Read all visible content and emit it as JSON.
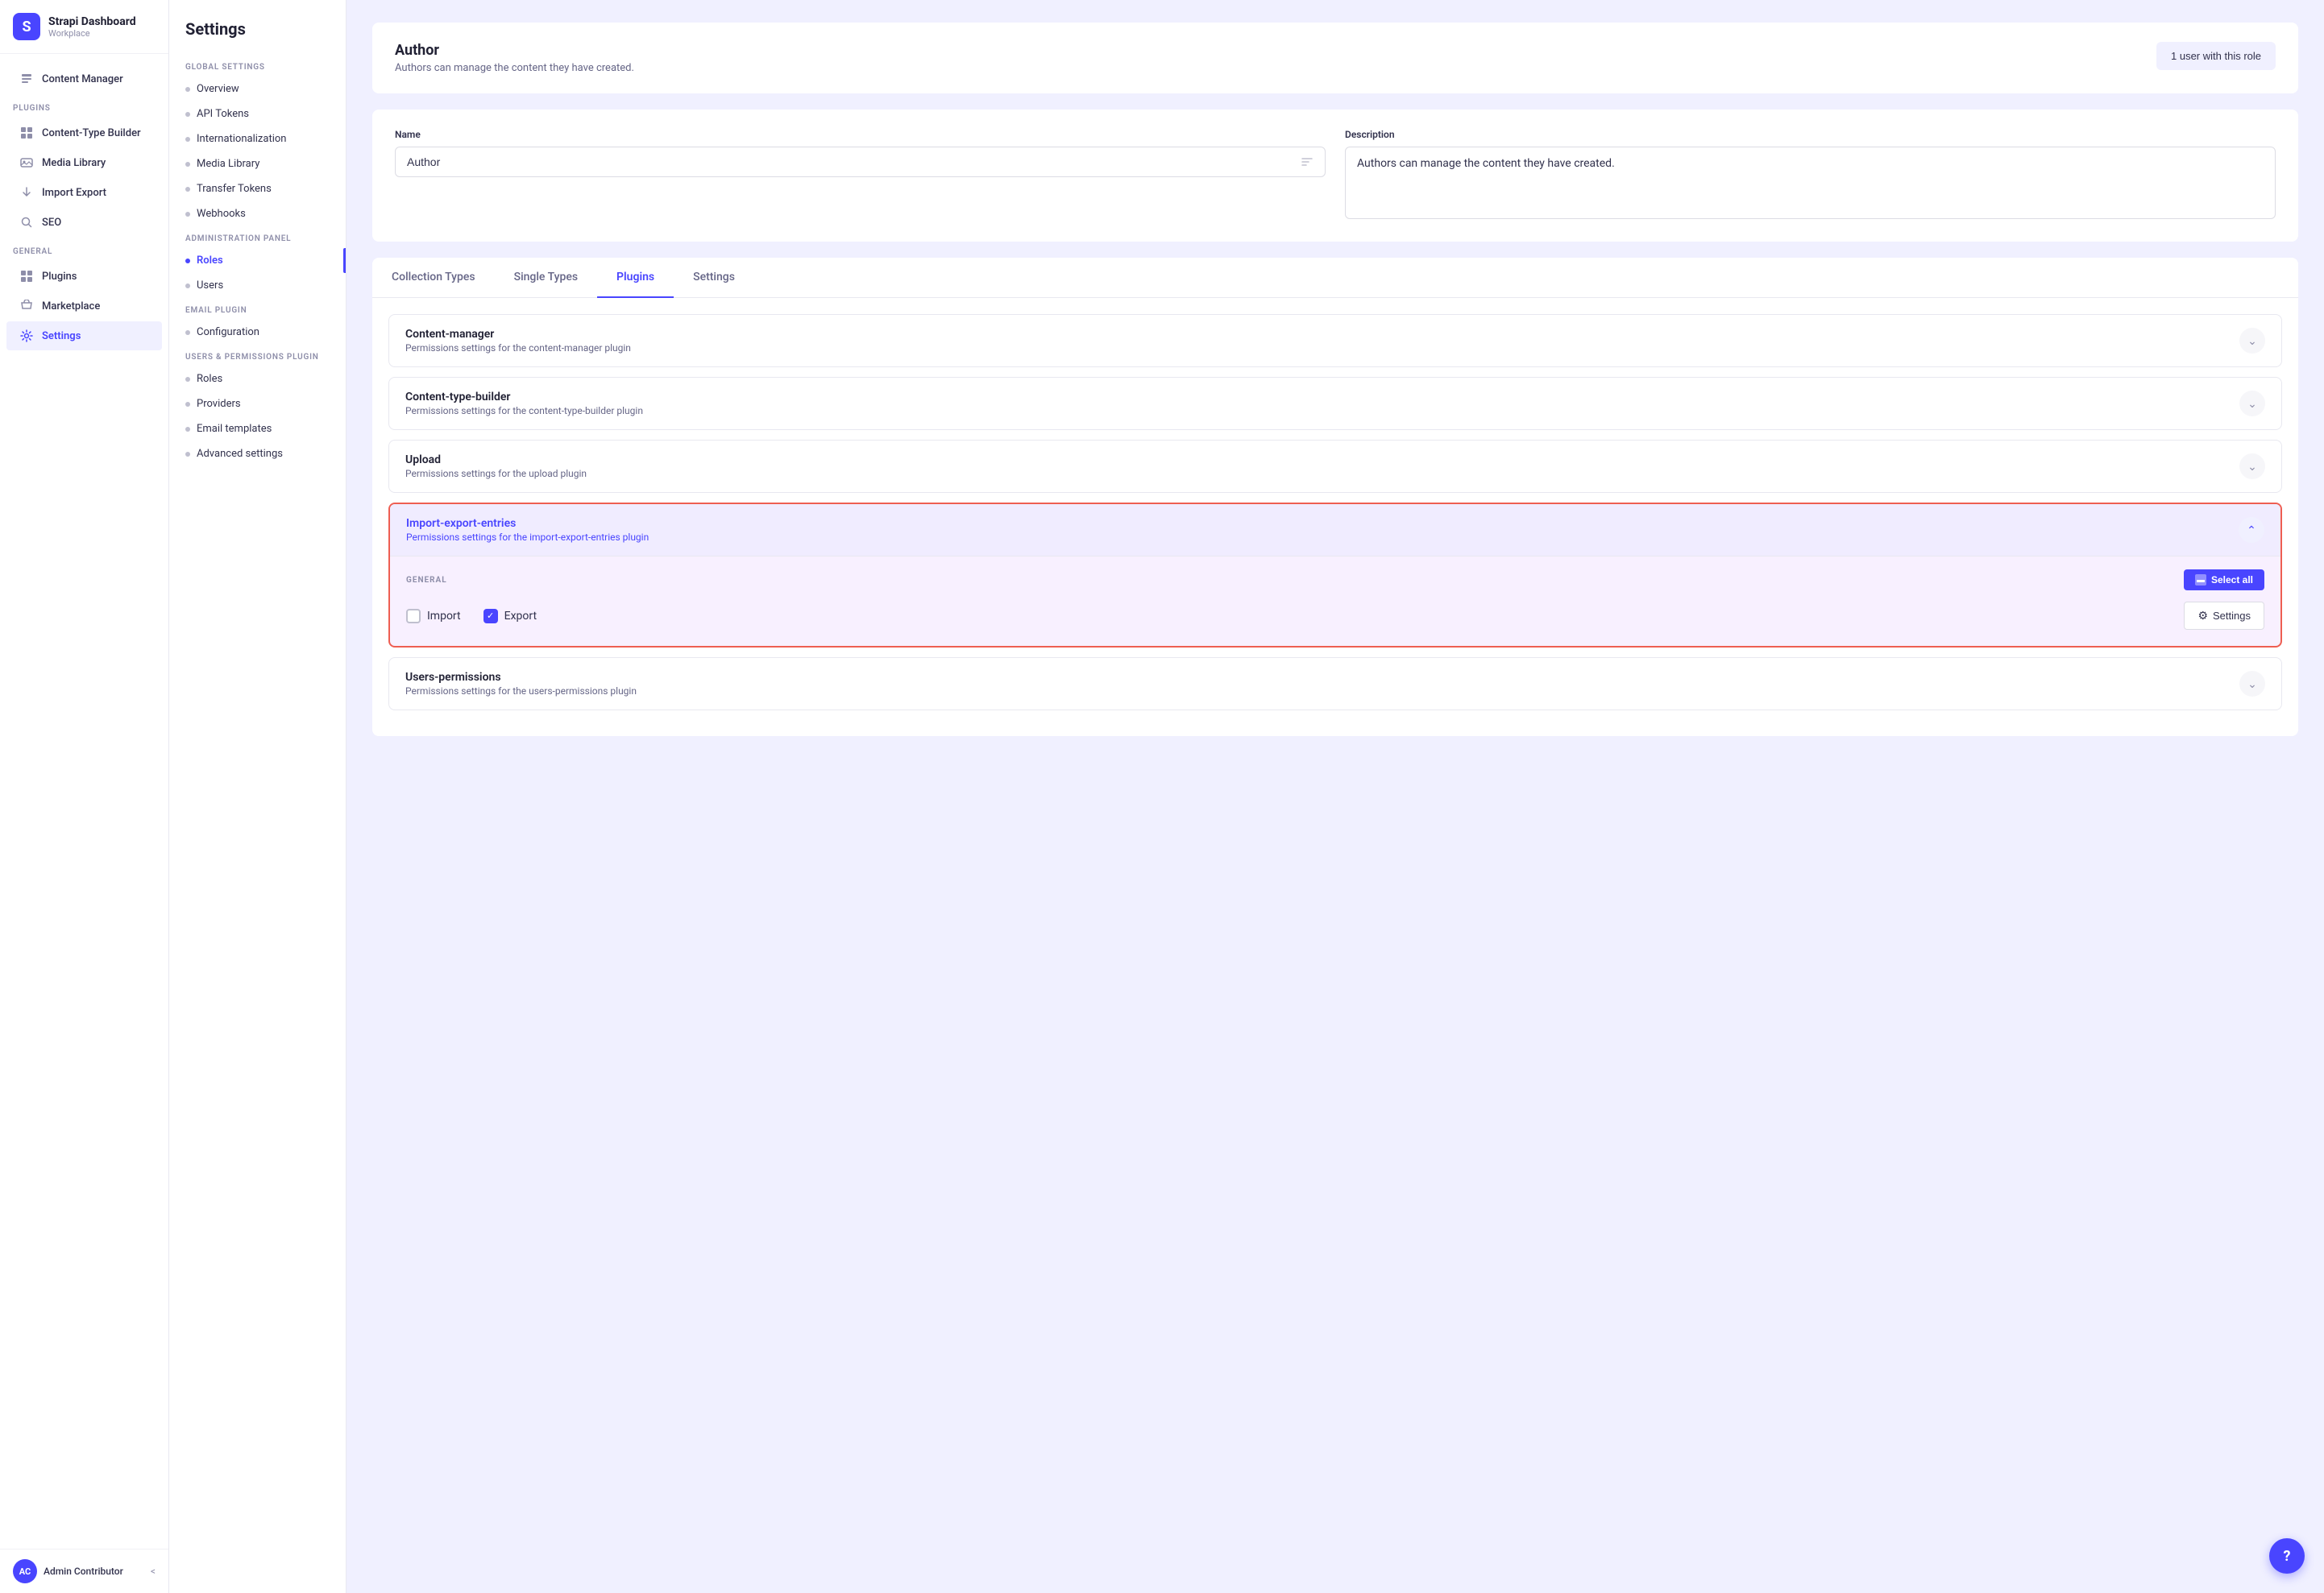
{
  "brand": {
    "icon": "S",
    "name": "Strapi Dashboard",
    "workplace": "Workplace"
  },
  "sidebar": {
    "items": [
      {
        "id": "content-manager",
        "label": "Content Manager",
        "icon": "✏️",
        "active": false
      },
      {
        "id": "content-type-builder",
        "label": "Content-Type Builder",
        "icon": "🧩",
        "active": false
      },
      {
        "id": "media-library",
        "label": "Media Library",
        "icon": "🖼️",
        "active": false
      },
      {
        "id": "import-export",
        "label": "Import Export",
        "icon": "📋",
        "active": false
      },
      {
        "id": "seo",
        "label": "SEO",
        "icon": "🔍",
        "active": false
      }
    ],
    "general_section": "GENERAL",
    "general_items": [
      {
        "id": "plugins",
        "label": "Plugins",
        "icon": "🧩",
        "active": false
      },
      {
        "id": "marketplace",
        "label": "Marketplace",
        "icon": "🛒",
        "active": false
      },
      {
        "id": "settings",
        "label": "Settings",
        "icon": "⚙️",
        "active": true
      }
    ],
    "plugins_section": "PLUGINS"
  },
  "user": {
    "initials": "AC",
    "name": "Admin Contributor",
    "chevron": "<"
  },
  "settings": {
    "title": "Settings",
    "global_settings_label": "GLOBAL SETTINGS",
    "global_items": [
      {
        "id": "overview",
        "label": "Overview",
        "active": false
      },
      {
        "id": "api-tokens",
        "label": "API Tokens",
        "active": false
      },
      {
        "id": "internationalization",
        "label": "Internationalization",
        "active": false
      },
      {
        "id": "media-library",
        "label": "Media Library",
        "active": false
      },
      {
        "id": "transfer-tokens",
        "label": "Transfer Tokens",
        "active": false
      },
      {
        "id": "webhooks",
        "label": "Webhooks",
        "active": false
      }
    ],
    "admin_panel_label": "ADMINISTRATION PANEL",
    "admin_items": [
      {
        "id": "roles",
        "label": "Roles",
        "active": true
      },
      {
        "id": "users",
        "label": "Users",
        "active": false
      }
    ],
    "email_plugin_label": "EMAIL PLUGIN",
    "email_items": [
      {
        "id": "configuration",
        "label": "Configuration",
        "active": false
      }
    ],
    "users_permissions_label": "USERS & PERMISSIONS PLUGIN",
    "users_permissions_items": [
      {
        "id": "up-roles",
        "label": "Roles",
        "active": false
      },
      {
        "id": "providers",
        "label": "Providers",
        "active": false
      },
      {
        "id": "email-templates",
        "label": "Email templates",
        "active": false
      },
      {
        "id": "advanced-settings",
        "label": "Advanced settings",
        "active": false
      }
    ]
  },
  "author": {
    "title": "Author",
    "description": "Authors can manage the content they have created.",
    "user_role_btn": "1 user with this role",
    "form": {
      "name_label": "Name",
      "name_value": "Author",
      "description_label": "Description",
      "description_value": "Authors can manage the content they have created."
    }
  },
  "tabs": {
    "items": [
      {
        "id": "collection-types",
        "label": "Collection Types",
        "active": false
      },
      {
        "id": "single-types",
        "label": "Single Types",
        "active": false
      },
      {
        "id": "plugins",
        "label": "Plugins",
        "active": true
      },
      {
        "id": "settings-tab",
        "label": "Settings",
        "active": false
      }
    ]
  },
  "plugins": {
    "sections": [
      {
        "id": "content-manager",
        "name": "Content-manager",
        "desc": "Permissions settings for the content-manager plugin",
        "expanded": false,
        "highlighted": false
      },
      {
        "id": "content-type-builder",
        "name": "Content-type-builder",
        "desc": "Permissions settings for the content-type-builder plugin",
        "expanded": false,
        "highlighted": false
      },
      {
        "id": "upload",
        "name": "Upload",
        "desc": "Permissions settings for the upload plugin",
        "expanded": false,
        "highlighted": false
      },
      {
        "id": "import-export-entries",
        "name": "Import-export-entries",
        "desc": "Permissions settings for the import-export-entries plugin",
        "expanded": true,
        "highlighted": true,
        "general_label": "GENERAL",
        "select_all_label": "Select all",
        "checkboxes": [
          {
            "id": "import",
            "label": "Import",
            "checked": false
          },
          {
            "id": "export",
            "label": "Export",
            "checked": true
          }
        ],
        "settings_btn": "Settings"
      },
      {
        "id": "users-permissions",
        "name": "Users-permissions",
        "desc": "Permissions settings for the users-permissions plugin",
        "expanded": false,
        "highlighted": false
      }
    ]
  },
  "help_btn": "?"
}
